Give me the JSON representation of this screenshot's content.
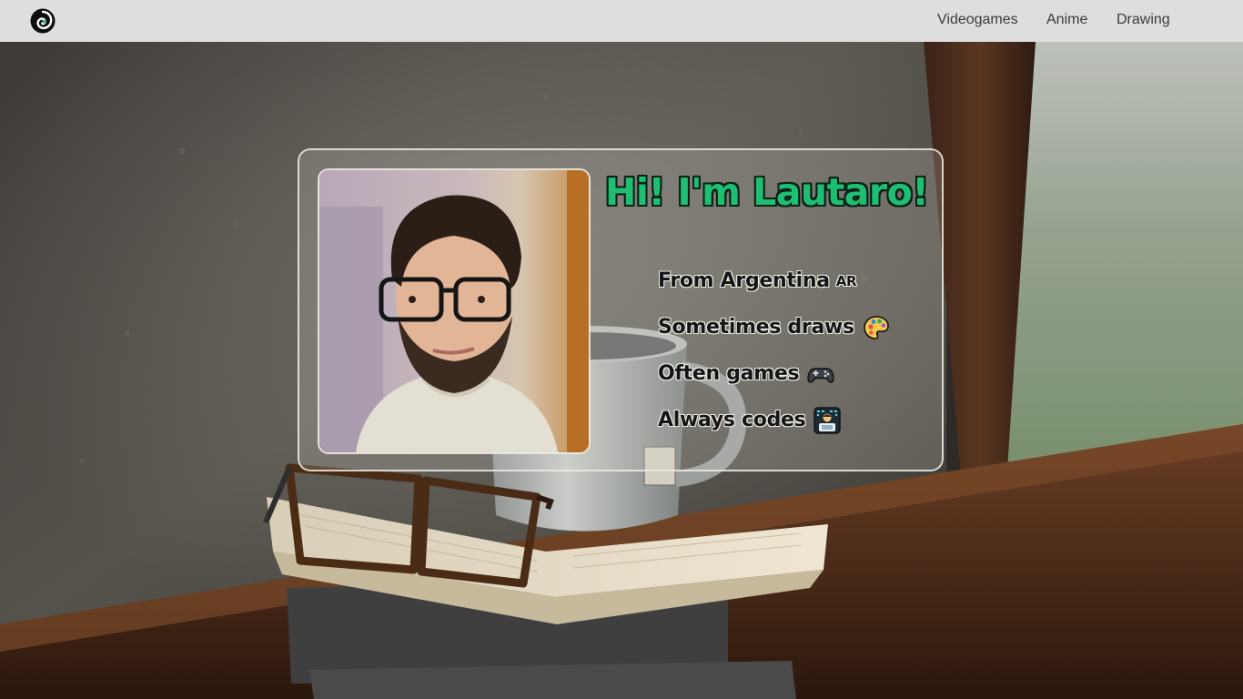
{
  "nav": {
    "logo_icon": "swirl-logo-icon",
    "links": [
      {
        "label": "Videogames"
      },
      {
        "label": "Anime"
      },
      {
        "label": "Drawing"
      }
    ]
  },
  "card": {
    "title": "Hi! I'm Lautaro!",
    "title_color": "#1fbf73",
    "photo_icon": "profile-photo",
    "facts": [
      {
        "text": "From Argentina",
        "badge": "AR",
        "icon": "flag-badge"
      },
      {
        "text": "Sometimes draws",
        "icon": "artist-palette-icon"
      },
      {
        "text": "Often games",
        "icon": "game-controller-icon"
      },
      {
        "text": "Always codes",
        "icon": "technologist-icon"
      }
    ]
  },
  "colors": {
    "topbar": "#dedede",
    "accent": "#1fbf73"
  }
}
